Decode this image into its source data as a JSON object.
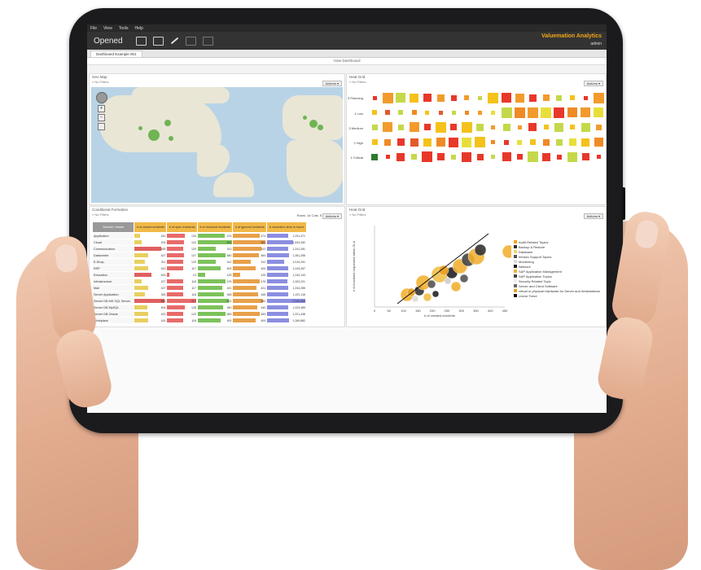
{
  "menu": [
    "File",
    "View",
    "Tools",
    "Help"
  ],
  "header": {
    "title": "Opened",
    "brand": "Valuemation Analytics",
    "user": "admin"
  },
  "tab": {
    "label": "Dashboard Example 001"
  },
  "view": {
    "label": "View Dashboard"
  },
  "geomap": {
    "title": "Geo Map",
    "filter": "» No Filters",
    "actions": "Actions ▾"
  },
  "heatgrid": {
    "title": "Heat Grid",
    "filter": "» No Filters",
    "actions": "Actions ▾",
    "rows": [
      "5 Planning",
      "4 Low",
      "3 Medium",
      "2 High",
      "1 Critical"
    ]
  },
  "conditional": {
    "title": "Conditional Formation",
    "filter": "» No Filters",
    "rows_info": "Rows: 14  Cols: 5",
    "actions": "Actions ▾",
    "headers": [
      "Service / Name",
      "# of closed incidents",
      "# of open incidents",
      "# of resolved incidents",
      "# of ignored incidents",
      "# resolution time in hours"
    ],
    "rows": [
      {
        "name": "Application",
        "v": [
          "181",
          "133",
          "474",
          "474",
          "1,231,471"
        ]
      },
      {
        "name": "Cloud",
        "v": [
          "224",
          "122",
          "591",
          "581",
          "1,543,282"
        ]
      },
      {
        "name": "Communication",
        "v": [
          "828",
          "120",
          "312",
          "512",
          "1,241,281"
        ]
      },
      {
        "name": "Datacenter",
        "v": [
          "427",
          "127",
          "480",
          "460",
          "1,281,256"
        ]
      },
      {
        "name": "E-Shop",
        "v": [
          "311",
          "120",
          "312",
          "312",
          "1,019,291"
        ]
      },
      {
        "name": "ERP",
        "v": [
          "423",
          "117",
          "400",
          "400",
          "1,243,267"
        ]
      },
      {
        "name": "Education",
        "v": [
          "515",
          "13",
          "125",
          "125",
          "1,243,143"
        ]
      },
      {
        "name": "Infrastructure",
        "v": [
          "227",
          "118",
          "476",
          "476",
          "1,203,221"
        ]
      },
      {
        "name": "Mail",
        "v": [
          "427",
          "117",
          "421",
          "421",
          "1,234,285"
        ]
      },
      {
        "name": "Server Application",
        "v": [
          "326",
          "118",
          "448",
          "448",
          "1,221,116"
        ]
      },
      {
        "name": "Server DB MS SQL Server",
        "v": [
          "928",
          "217",
          "532",
          "532",
          "2,249,483"
        ]
      },
      {
        "name": "Server DB MySQL",
        "v": [
          "404",
          "128",
          "440",
          "440",
          "1,223,485"
        ]
      },
      {
        "name": "Server DB Oracle",
        "v": [
          "423",
          "120",
          "483",
          "483",
          "1,221,438"
        ]
      },
      {
        "name": "Workplace",
        "v": [
          "424",
          "118",
          "400",
          "400",
          "1,269,882"
        ]
      }
    ]
  },
  "scatter": {
    "title": "Heat Grid",
    "filter": "» No Filters",
    "actions": "Actions ▾",
    "ylabel": "# of incidents requested within SLA",
    "xlabel": "# of created incidents",
    "xticks": [
      "0",
      "50",
      "100",
      "150",
      "200",
      "250",
      "300",
      "350",
      "400",
      "450"
    ],
    "legend": [
      {
        "label": "Audit Related Topics",
        "color": "#f2a516"
      },
      {
        "label": "Backup & Restore",
        "color": "#333333"
      },
      {
        "label": "Database",
        "color": "#f6d36b"
      },
      {
        "label": "Infosec Support Topics",
        "color": "#555555"
      },
      {
        "label": "Monitoring",
        "color": "#dddddd"
      },
      {
        "label": "Network",
        "color": "#222222"
      },
      {
        "label": "SAP Application Management",
        "color": "#f0b030"
      },
      {
        "label": "SAP Application Topics",
        "color": "#444444"
      },
      {
        "label": "Security Related Topic",
        "color": "#eeeeee"
      },
      {
        "label": "Server and Client Software",
        "color": "#666666"
      },
      {
        "label": "virtual or physical Hardware for Server and Workstations",
        "color": "#e8a020"
      },
      {
        "label": "Linear Trend",
        "color": "#111111"
      }
    ]
  }
}
